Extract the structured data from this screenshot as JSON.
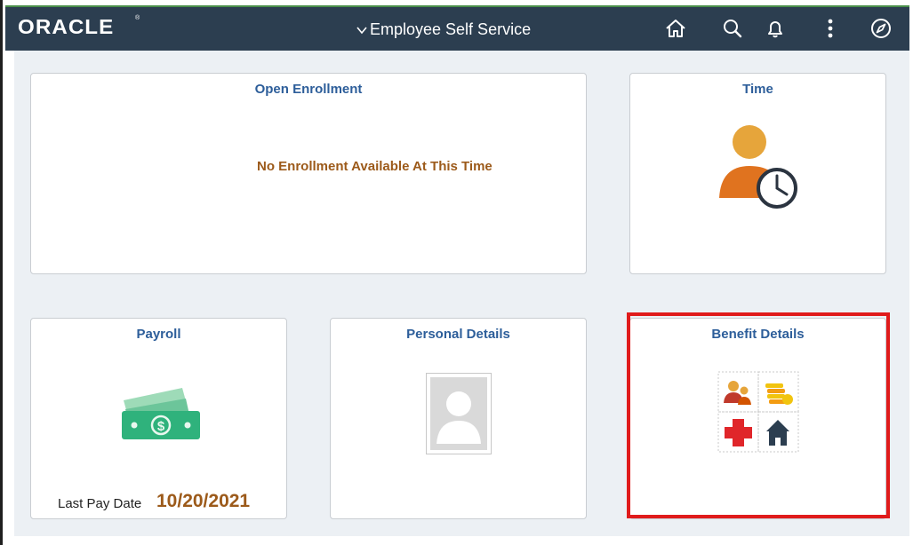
{
  "header": {
    "logo": "ORACLE",
    "logo_mark": "®",
    "nav_title": "Employee Self Service",
    "icons": [
      "home-icon",
      "search-icon",
      "bell-icon",
      "more-options-icon",
      "compass-icon"
    ]
  },
  "tiles": {
    "open_enrollment": {
      "title": "Open Enrollment",
      "message": "No Enrollment Available At This Time"
    },
    "time": {
      "title": "Time"
    },
    "payroll": {
      "title": "Payroll",
      "last_pay_label": "Last Pay Date",
      "last_pay_date": "10/20/2021"
    },
    "personal_details": {
      "title": "Personal Details"
    },
    "benefit_details": {
      "title": "Benefit Details"
    }
  },
  "colors": {
    "header_bg": "#2c3e50",
    "tile_title": "#2d5e9a",
    "accent_brown": "#9c5a1a",
    "highlight": "#e01b1b",
    "background": "#ecf0f4"
  }
}
